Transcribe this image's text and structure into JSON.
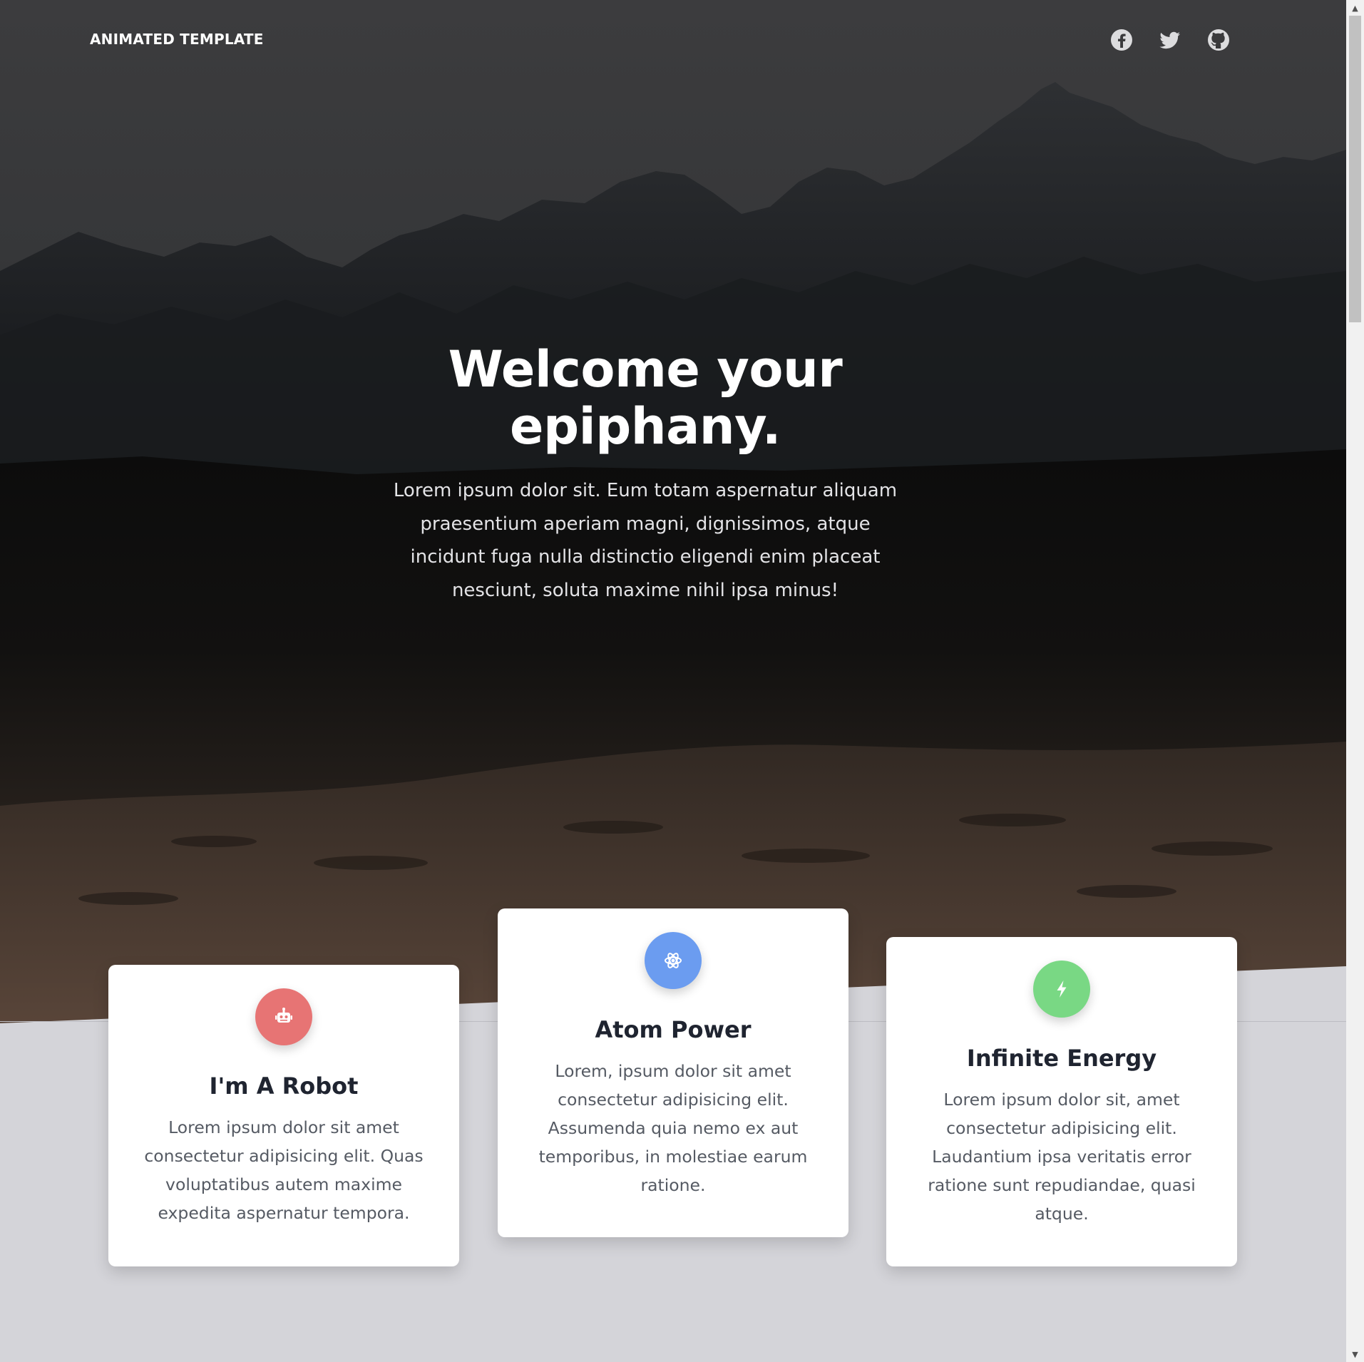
{
  "nav": {
    "brand": "ANIMATED TEMPLATE",
    "social": [
      {
        "icon": "facebook-icon"
      },
      {
        "icon": "twitter-icon"
      },
      {
        "icon": "github-icon"
      }
    ]
  },
  "hero": {
    "title_line1": "Welcome your",
    "title_line2": "epiphany.",
    "text": "Lorem ipsum dolor sit. Eum totam aspernatur aliquam praesentium aperiam magni, dignissimos, atque incidunt fuga nulla distinctio eligendi enim placeat nesciunt, soluta maxime nihil ipsa minus!"
  },
  "cards": [
    {
      "icon": "robot-icon",
      "icon_color": "#e77474",
      "title": "I'm A Robot",
      "text": "Lorem ipsum dolor sit amet consectetur adipisicing elit. Quas voluptatibus autem maxime expedita aspernatur tempora."
    },
    {
      "icon": "atom-icon",
      "icon_color": "#6b9cf0",
      "title": "Atom Power",
      "text": "Lorem, ipsum dolor sit amet consectetur adipisicing elit. Assumenda quia nemo ex aut temporibus, in molestiae earum ratione."
    },
    {
      "icon": "bolt-icon",
      "icon_color": "#79d884",
      "title": "Infinite Energy",
      "text": "Lorem ipsum dolor sit, amet consectetur adipisicing elit. Laudantium ipsa veritatis error ratione sunt repudiandae, quasi atque."
    }
  ],
  "colors": {
    "light_section": "#d4d4d9",
    "card_background": "#ffffff"
  }
}
